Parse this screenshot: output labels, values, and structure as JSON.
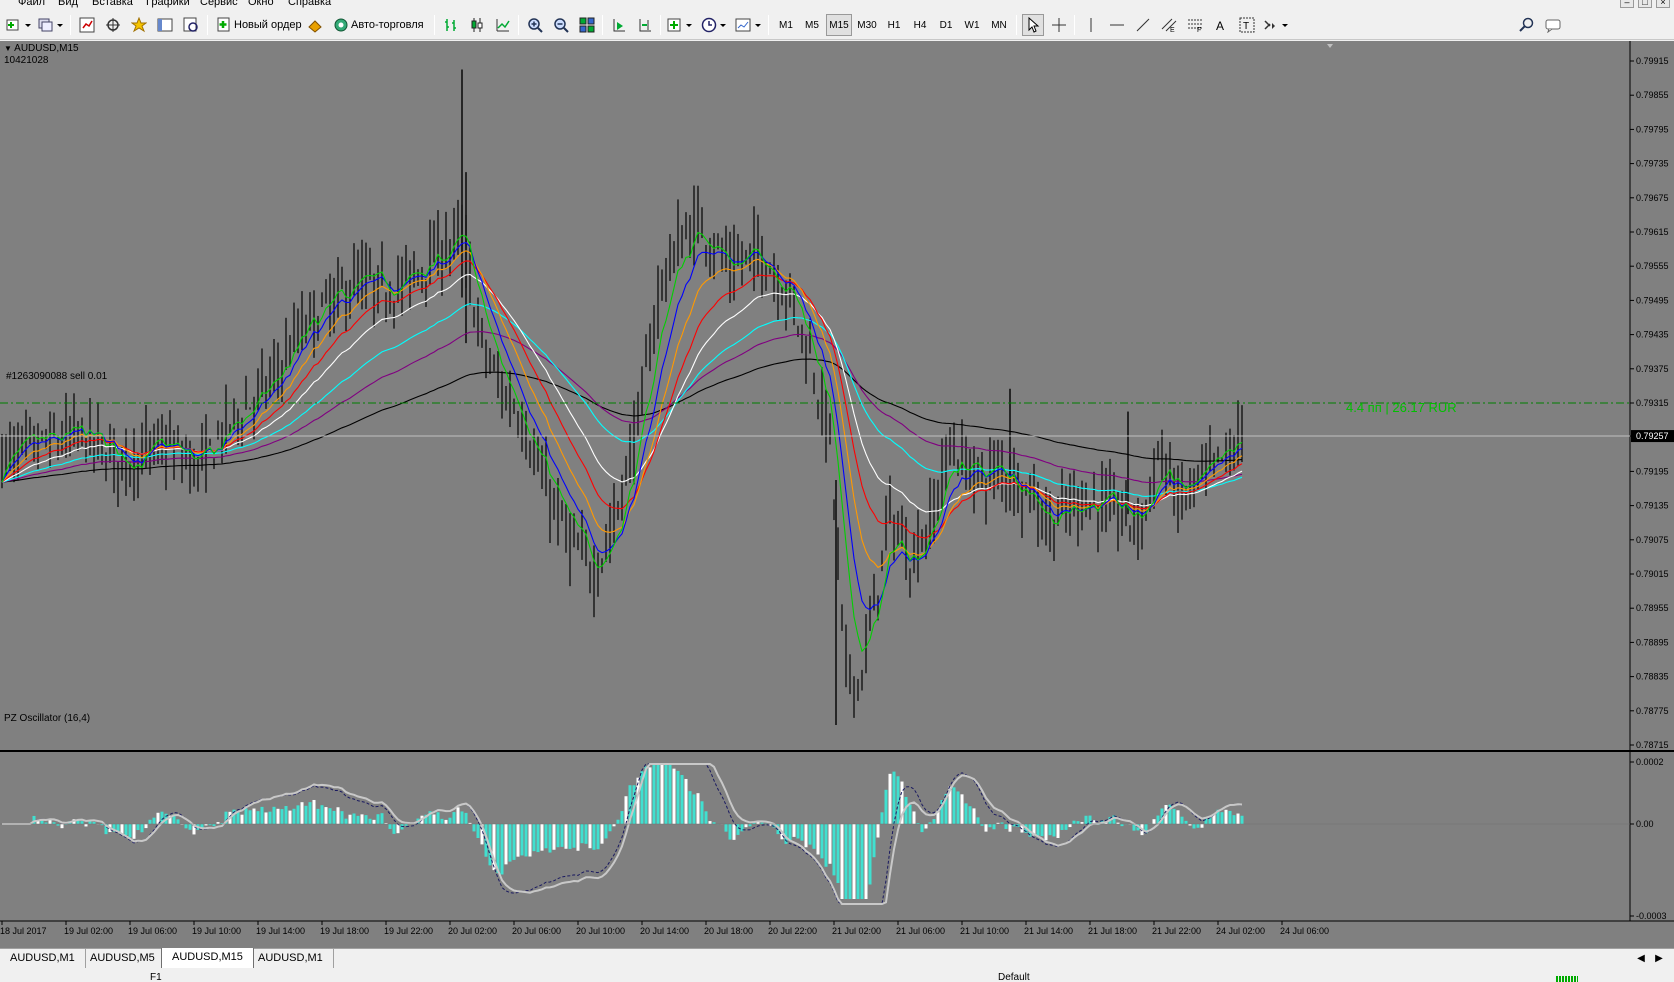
{
  "menu": {
    "items": [
      "Файл",
      "Вид",
      "Вставка",
      "Графики",
      "Сервис",
      "Окно",
      "Справка"
    ]
  },
  "toolbar": {
    "new_order_label": "Новый ордер",
    "autotrade_label": "Авто-торговля",
    "timeframes": [
      "M1",
      "M5",
      "M15",
      "M30",
      "H1",
      "H4",
      "D1",
      "W1",
      "MN"
    ],
    "active_timeframe": "M15"
  },
  "chart": {
    "symbol_title": "AUDUSD,M15",
    "account_number": "10421028",
    "order_label": "#1263090088 sell 0.01",
    "profit_label": "4.4 пп | 26.17 RUR",
    "current_price": "0.79257",
    "price_ticks": [
      "0.79915",
      "0.79855",
      "0.79795",
      "0.79735",
      "0.79675",
      "0.79615",
      "0.79555",
      "0.79495",
      "0.79435",
      "0.79375",
      "0.79315",
      "0.79257",
      "0.79195",
      "0.79135",
      "0.79075",
      "0.79015",
      "0.78955",
      "0.78895",
      "0.78835",
      "0.78775",
      "0.78715"
    ],
    "time_ticks": [
      "18 Jul 2017",
      "19 Jul 02:00",
      "19 Jul 06:00",
      "19 Jul 10:00",
      "19 Jul 14:00",
      "19 Jul 18:00",
      "19 Jul 22:00",
      "20 Jul 02:00",
      "20 Jul 06:00",
      "20 Jul 10:00",
      "20 Jul 14:00",
      "20 Jul 18:00",
      "20 Jul 22:00",
      "21 Jul 02:00",
      "21 Jul 06:00",
      "21 Jul 10:00",
      "21 Jul 14:00",
      "21 Jul 18:00",
      "21 Jul 22:00",
      "24 Jul 02:00",
      "24 Jul 06:00"
    ],
    "colors": {
      "background": "#808080",
      "candles": "#000000",
      "order_line": "#008000",
      "profit_text": "#00c000",
      "bid_line": "#c0c0c0",
      "ma_green": "#00d000",
      "ma_blue": "#0000ff",
      "ma_orange": "#ff9900",
      "ma_red": "#ff0000",
      "ma_white": "#ffffff",
      "ma_cyan": "#00ffff",
      "ma_purple": "#800080",
      "ma_black": "#000000",
      "histogram_cyan": "#40e0d0",
      "histogram_white": "#ffffff"
    }
  },
  "oscillator": {
    "title": "PZ Oscillator (16,4)",
    "ticks": [
      "0.0002",
      "0.00",
      "-0.0003"
    ]
  },
  "chart_data": {
    "type": "candlestick",
    "symbol": "AUDUSD",
    "timeframe": "M15",
    "ylim": [
      0.78715,
      0.79915
    ],
    "current_price": 0.79257,
    "order_price": 0.79315,
    "price_path": [
      [
        0,
        0.7922
      ],
      [
        80,
        0.7926
      ],
      [
        120,
        0.7921
      ],
      [
        165,
        0.7924
      ],
      [
        200,
        0.792
      ],
      [
        230,
        0.7928
      ],
      [
        270,
        0.7935
      ],
      [
        300,
        0.7944
      ],
      [
        330,
        0.7949
      ],
      [
        360,
        0.7953
      ],
      [
        380,
        0.7951
      ],
      [
        400,
        0.7952
      ],
      [
        440,
        0.7958
      ],
      [
        462,
        0.7961
      ],
      [
        480,
        0.7943
      ],
      [
        500,
        0.7934
      ],
      [
        520,
        0.793
      ],
      [
        540,
        0.7919
      ],
      [
        570,
        0.7907
      ],
      [
        595,
        0.7902
      ],
      [
        615,
        0.7911
      ],
      [
        640,
        0.793
      ],
      [
        660,
        0.7952
      ],
      [
        680,
        0.796
      ],
      [
        700,
        0.7963
      ],
      [
        730,
        0.7955
      ],
      [
        760,
        0.7958
      ],
      [
        790,
        0.795
      ],
      [
        810,
        0.794
      ],
      [
        830,
        0.7925
      ],
      [
        845,
        0.7885
      ],
      [
        860,
        0.7882
      ],
      [
        875,
        0.7897
      ],
      [
        890,
        0.7912
      ],
      [
        910,
        0.7904
      ],
      [
        930,
        0.791
      ],
      [
        950,
        0.7924
      ],
      [
        980,
        0.7918
      ],
      [
        1000,
        0.792
      ],
      [
        1030,
        0.7916
      ],
      [
        1050,
        0.791
      ],
      [
        1080,
        0.7915
      ],
      [
        1110,
        0.7913
      ],
      [
        1140,
        0.791
      ],
      [
        1160,
        0.7923
      ],
      [
        1180,
        0.7914
      ],
      [
        1200,
        0.7918
      ],
      [
        1220,
        0.7921
      ],
      [
        1245,
        0.7926
      ]
    ]
  }
}
